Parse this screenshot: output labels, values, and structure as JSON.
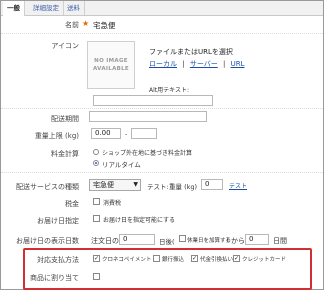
{
  "tabs": [
    "一般",
    "詳細設定",
    "送料"
  ],
  "fields": {
    "name": {
      "label": "名前",
      "value": "宅急便"
    },
    "icon": {
      "label": "アイコン",
      "noimage_line1": "NO IMAGE",
      "noimage_line2": "AVAILABLE",
      "upload_title": "ファイルまたはURLを選択",
      "link_local": "ローカル",
      "link_server": "サーバー",
      "link_url": "URL",
      "sep": "|",
      "alt_label": "Alt用テキスト:"
    },
    "delivery_period": {
      "label": "配送期間",
      "value": ""
    },
    "weight_limit": {
      "label": "重量上限 (kg)",
      "from": "0.00",
      "dash": "-",
      "to": ""
    },
    "fee_calc": {
      "label": "料金計算",
      "options": [
        "ショップ外在地に基づき料金計算",
        "リアルタイム"
      ],
      "selected": 1
    },
    "service_type": {
      "label": "配送サービスの種類",
      "value": "宅急便",
      "test_label": "テスト:",
      "weight_label": "重量 (kg)",
      "weight_value": "0",
      "test_link": "テスト"
    },
    "tax": {
      "label": "税金",
      "checkbox_label": "消費税",
      "checked": false
    },
    "date_spec": {
      "label": "お届け日指定",
      "checkbox_label": "お届け日を指定可能にする",
      "checked": false
    },
    "display_days": {
      "label": "お届け日の表示日数",
      "order_label": "注文日の",
      "from_value": "0",
      "after_label": "日後(",
      "holiday_label": "休業日を加算する",
      "close_paren": ")",
      "kara": "から",
      "to_value": "0",
      "days_label": "日間"
    },
    "payment": {
      "label": "対応支払方法",
      "options": [
        "クロネコペイメント",
        "銀行振込",
        "代金引換払い",
        "クレジットカード"
      ],
      "checked": [
        true,
        false,
        true,
        true
      ]
    },
    "product_assign": {
      "label": "商品に割り当て",
      "checked": false
    }
  }
}
